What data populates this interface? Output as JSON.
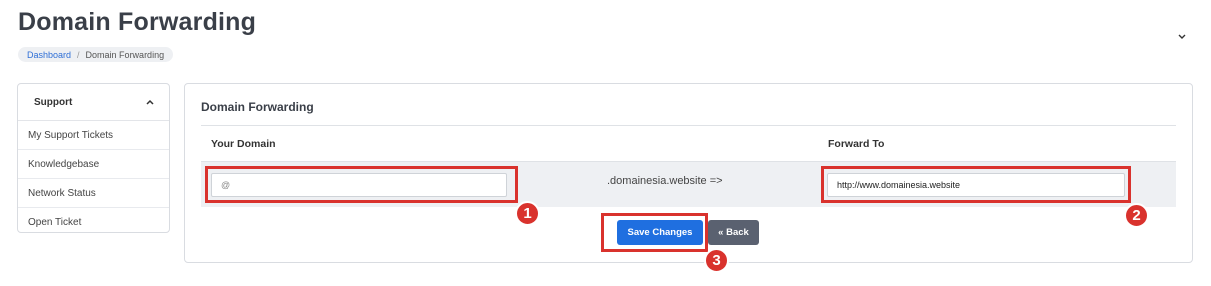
{
  "header": {
    "title": "Domain Forwarding",
    "breadcrumb": [
      {
        "label": "Dashboard"
      },
      {
        "label": "Domain Forwarding"
      }
    ]
  },
  "sidebar": {
    "title": "Support",
    "items": [
      {
        "label": "My Support Tickets"
      },
      {
        "label": "Knowledgebase"
      },
      {
        "label": "Network Status"
      },
      {
        "label": "Open Ticket"
      }
    ]
  },
  "card": {
    "title": "Domain Forwarding",
    "col_your_domain": "Your Domain",
    "col_forward_to": "Forward To",
    "domain_input_placeholder": "@",
    "domain_suffix": ".domainesia.website =>",
    "forward_input_value": "http://www.domainesia.website",
    "save_label": "Save Changes",
    "back_label": "« Back"
  },
  "annotations": [
    "1",
    "2",
    "3"
  ],
  "colors": {
    "primary": "#1f6fe0",
    "secondary": "#5a6170",
    "highlight": "#d9322d"
  }
}
